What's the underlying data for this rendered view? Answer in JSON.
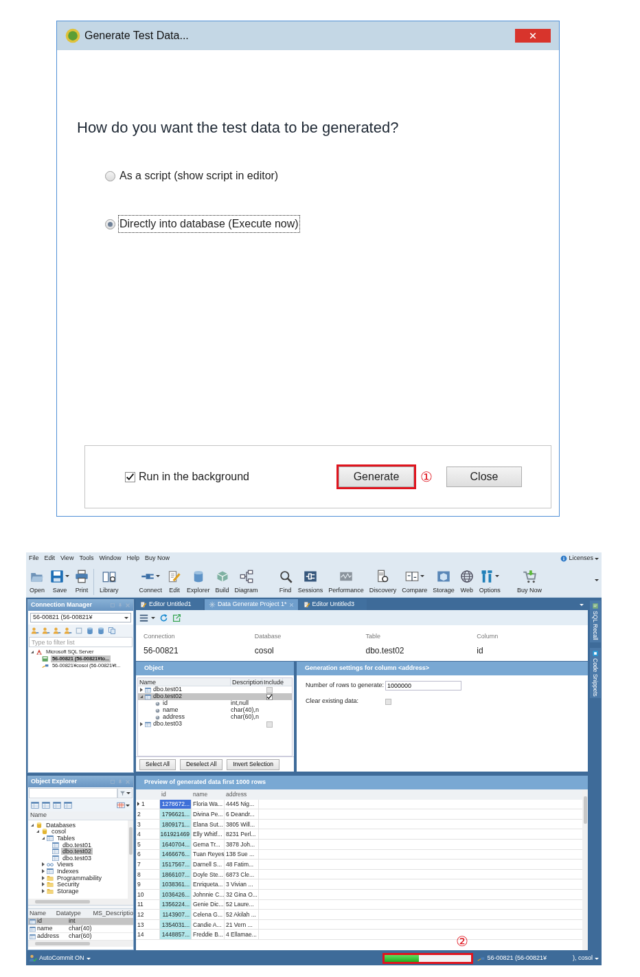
{
  "dialog": {
    "title": "Generate Test Data...",
    "question": "How do you want the test data to be generated?",
    "options": [
      {
        "label": "As a script (show script in editor)",
        "selected": false
      },
      {
        "label": "Directly into database (Execute now)",
        "selected": true
      }
    ],
    "background": {
      "label": "Run in the background",
      "checked": true
    },
    "buttons": [
      {
        "label": "Generate",
        "highlighted": true,
        "callout": "①"
      },
      {
        "label": "Close",
        "highlighted": false
      }
    ]
  },
  "app": {
    "menu": [
      "File",
      "Edit",
      "View",
      "Tools",
      "Window",
      "Help",
      "Buy Now"
    ],
    "licenses": "Licenses",
    "toolbar_groups": [
      {
        "items": [
          {
            "label": "Open"
          },
          {
            "label": "Save",
            "dropdown": true
          },
          {
            "label": "Print"
          },
          {
            "label": "Library",
            "separator_before": true
          }
        ]
      },
      {
        "items": [
          {
            "label": "Connect",
            "dropdown": true
          },
          {
            "label": "Edit"
          },
          {
            "label": "Explorer"
          },
          {
            "label": "Build"
          },
          {
            "label": "Diagram"
          }
        ]
      },
      {
        "items": [
          {
            "label": "Find"
          },
          {
            "label": "Sessions"
          },
          {
            "label": "Performance"
          },
          {
            "label": "Discovery"
          },
          {
            "label": "Compare",
            "dropdown": true
          },
          {
            "label": "Storage"
          },
          {
            "label": "Web"
          },
          {
            "label": "Options",
            "dropdown": true
          }
        ]
      },
      {
        "items": [
          {
            "label": "Buy Now"
          }
        ]
      }
    ],
    "connection_manager": {
      "title": "Connection Manager",
      "connection": "56-00821 (56-00821¥",
      "filter_placeholder": "Type to filter list",
      "tree": [
        {
          "label": "Microsoft SQL Server",
          "kind": "server",
          "expanded": true,
          "selected": false,
          "children": [
            {
              "label": "56-00821 (56-00821¥to...",
              "kind": "active-connection",
              "selected": true
            },
            {
              "label": "56-00821¥cosol (56-00821¥t...",
              "kind": "connection",
              "selected": false
            }
          ]
        }
      ]
    },
    "object_explorer": {
      "title": "Object Explorer",
      "tree_header": "Name",
      "tree": [
        {
          "label": "Databases",
          "kind": "database",
          "expanded": true,
          "selected": false,
          "children": [
            {
              "label": "cosol",
              "kind": "database",
              "expanded": true,
              "selected": false,
              "children": [
                {
                  "label": "Tables",
                  "kind": "tables",
                  "expanded": true,
                  "selected": false,
                  "children": [
                    {
                      "label": "dbo.test01",
                      "kind": "table",
                      "selected": false
                    },
                    {
                      "label": "dbo.test02",
                      "kind": "table",
                      "selected": true
                    },
                    {
                      "label": "dbo.test03",
                      "kind": "table",
                      "selected": false
                    }
                  ]
                },
                {
                  "label": "Views",
                  "kind": "views",
                  "expanded": false,
                  "selected": false
                },
                {
                  "label": "Indexes",
                  "kind": "indexes",
                  "expanded": false,
                  "selected": false
                },
                {
                  "label": "Programmability",
                  "kind": "folder",
                  "expanded": false,
                  "selected": false
                },
                {
                  "label": "Security",
                  "kind": "folder",
                  "expanded": false,
                  "selected": false
                },
                {
                  "label": "Storage",
                  "kind": "folder",
                  "expanded": false,
                  "selected": false
                }
              ]
            }
          ]
        }
      ],
      "columns": [
        "Name",
        "Datatype",
        "MS_Descriptio"
      ],
      "rows": [
        {
          "name": "id",
          "datatype": "int",
          "selected": true
        },
        {
          "name": "name",
          "datatype": "char(40)",
          "selected": false
        },
        {
          "name": "address",
          "datatype": "char(60)",
          "selected": false
        }
      ]
    },
    "tabs": [
      {
        "label": "Editor Untitled1",
        "kind": "editor",
        "selected": false
      },
      {
        "label": "Data Generate Project 1*",
        "kind": "generator",
        "selected": true
      },
      {
        "label": "Editor Untitled3",
        "kind": "editor",
        "selected": false
      }
    ],
    "info": [
      {
        "label": "Connection",
        "value": "56-00821"
      },
      {
        "label": "Database",
        "value": "cosol"
      },
      {
        "label": "Table",
        "value": "dbo.test02"
      },
      {
        "label": "Column",
        "value": "id"
      }
    ],
    "object_panel": {
      "title": "Object",
      "columns": [
        "Name",
        "Description",
        "Include"
      ],
      "rows": [
        {
          "label": "dbo.test01",
          "expanded": false,
          "include": false,
          "selected": false
        },
        {
          "label": "dbo.test02",
          "expanded": true,
          "include": true,
          "selected": true,
          "children": [
            {
              "label": "id",
              "description": "int,null",
              "selected": false
            },
            {
              "label": "name",
              "description": "char(40),n",
              "selected": false
            },
            {
              "label": "address",
              "description": "char(60),n",
              "selected": false
            }
          ]
        },
        {
          "label": "dbo.test03",
          "expanded": false,
          "include": false,
          "selected": false
        }
      ],
      "buttons": [
        "Select All",
        "Deselect All",
        "Invert Selection"
      ]
    },
    "settings": {
      "title": "Generation settings for column <address>",
      "rows_label": "Number of rows to generate:",
      "rows_value": "1000000",
      "clear_label": "Clear existing data:",
      "clear_checked": false
    },
    "preview": {
      "title": "Preview of generated data first 1000 rows",
      "columns": [
        "id",
        "name",
        "address"
      ],
      "rows": [
        {
          "number": "1",
          "id": "1278672...",
          "name": "Floria Wa...",
          "address": "4445 Nig...",
          "selected": true
        },
        {
          "number": "2",
          "id": "1796621...",
          "name": "Divina Pe...",
          "address": "6 Deandr...",
          "selected": false
        },
        {
          "number": "3",
          "id": "1809171...",
          "name": "Elana Sut...",
          "address": "3805 Will...",
          "selected": false
        },
        {
          "number": "4",
          "id": "161921469",
          "name": "Elly Whitf...",
          "address": "8231 Perl...",
          "selected": false
        },
        {
          "number": "5",
          "id": "1640704...",
          "name": "Gema Tr...",
          "address": "3878 Joh...",
          "selected": false
        },
        {
          "number": "6",
          "id": "1466676...",
          "name": "Tuan Reyes",
          "address": "138 Sue ...",
          "selected": false
        },
        {
          "number": "7",
          "id": "1517567...",
          "name": "Darnell S...",
          "address": "48 Fatim...",
          "selected": false
        },
        {
          "number": "8",
          "id": "1866107...",
          "name": "Doyle Ste...",
          "address": "6873 Cle...",
          "selected": false
        },
        {
          "number": "9",
          "id": "1038361...",
          "name": "Enriqueta...",
          "address": "3 Vivian ...",
          "selected": false
        },
        {
          "number": "10",
          "id": "1036426...",
          "name": "Johnnie C...",
          "address": "32 Gina O...",
          "selected": false
        },
        {
          "number": "11",
          "id": "1356224...",
          "name": "Genie Dic...",
          "address": "52 Laure...",
          "selected": false
        },
        {
          "number": "12",
          "id": "1143907...",
          "name": "Celena G...",
          "address": "52 Akilah ...",
          "selected": false
        },
        {
          "number": "13",
          "id": "1354031...",
          "name": "Candie A...",
          "address": "21 Vern ...",
          "selected": false
        },
        {
          "number": "14",
          "id": "1448857...",
          "name": "Freddie B...",
          "address": "4 Ellamae...",
          "selected": false
        }
      ]
    },
    "side_tabs": [
      "SQL Recall",
      "Code Snippets"
    ],
    "status": {
      "autocommit": "AutoCommit ON",
      "progress": {
        "level": 0.39,
        "callout": "②"
      },
      "connection": "56-00821 (56-00821¥",
      "database": "), cosol"
    }
  }
}
